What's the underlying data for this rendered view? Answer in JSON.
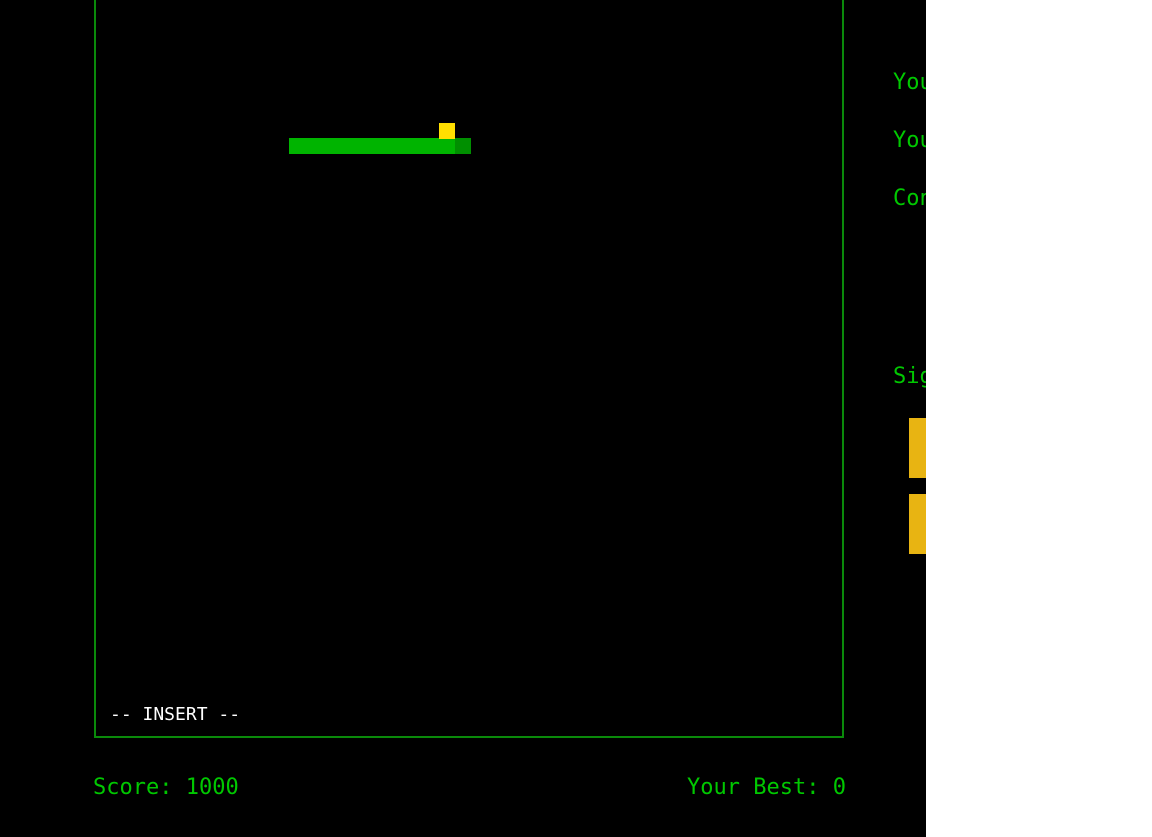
{
  "game": {
    "mode_text": "-- INSERT --",
    "score_label": "Score: 1000",
    "best_label": "Your Best: 0",
    "colors": {
      "background": "#000000",
      "border": "#0a8a0a",
      "snake_body": "#00b400",
      "snake_head": "#008f00",
      "food": "#ffdf00",
      "text": "#00c800",
      "button": "#e8b412"
    }
  },
  "side_panel": {
    "line1": "You",
    "line2": "You",
    "line3": "Con",
    "sign_label": "Sig",
    "buttons": [
      "",
      ""
    ]
  }
}
